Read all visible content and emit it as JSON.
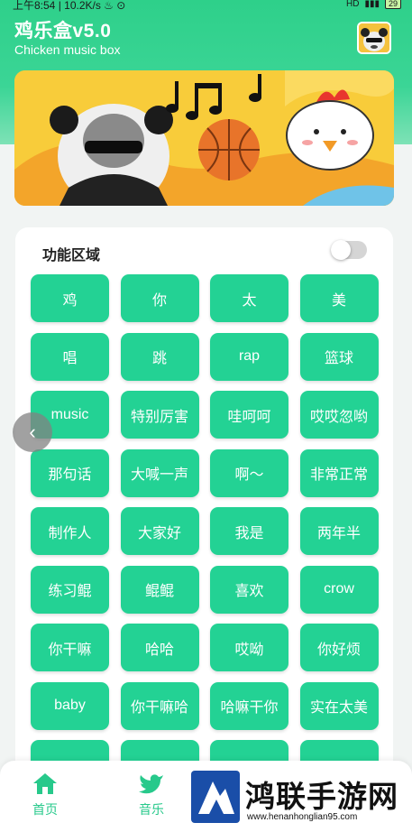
{
  "status_bar": {
    "text": "上午8:54 | 10.2K/s ♨ ⊙",
    "icons": [
      "hd-icon",
      "signal-icon",
      "wifi-icon"
    ],
    "battery": "29"
  },
  "header": {
    "title": "鸡乐盒v5.0",
    "subtitle": "Chicken music box",
    "avatar": "panda-meme-avatar"
  },
  "banner": {
    "description": "cartoon-banner"
  },
  "panel": {
    "title": "功能区域",
    "toggle_on": false,
    "buttons": [
      "鸡",
      "你",
      "太",
      "美",
      "唱",
      "跳",
      "rap",
      "篮球",
      "music",
      "特别厉害",
      "哇呵呵",
      "哎哎忽哟",
      "那句话",
      "大喊一声",
      "啊～",
      "非常正常",
      "制作人",
      "大家好",
      "我是",
      "两年半",
      "练习鲲",
      "鲲鲲",
      "喜欢",
      "crow",
      "你干嘛",
      "哈哈",
      "哎呦",
      "你好烦",
      "baby",
      "你干嘛哈",
      "哈嘛干你",
      "实在太美",
      "",
      "",
      "",
      ""
    ]
  },
  "bottom_nav": {
    "items": [
      {
        "label": "首页",
        "icon": "home-icon"
      },
      {
        "label": "音乐",
        "icon": "bird-icon"
      }
    ]
  },
  "watermark": {
    "title": "鸿联手游网",
    "url": "www.henanhonglian95.com"
  },
  "colors": {
    "accent": "#23d294",
    "header": "#2ed08a"
  }
}
